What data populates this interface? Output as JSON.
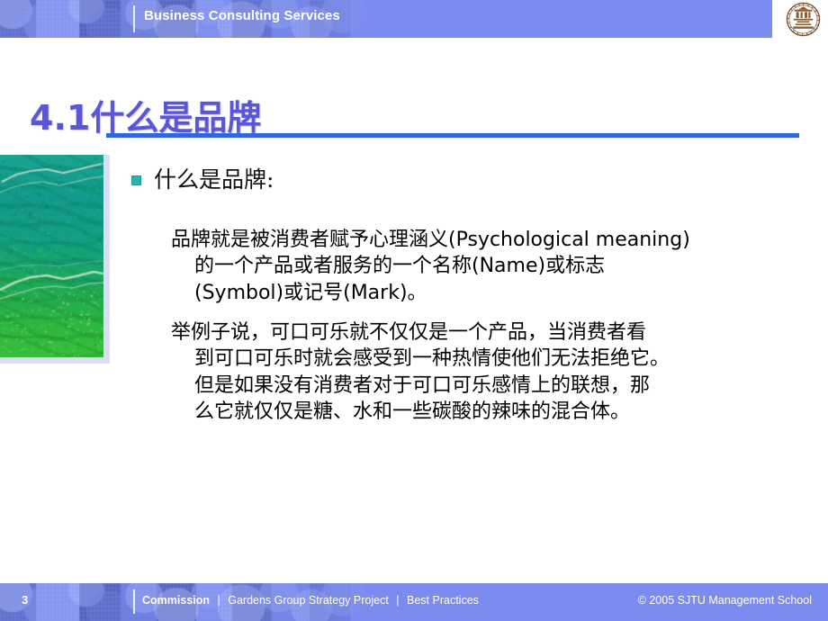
{
  "header": {
    "title": "Business Consulting Services",
    "logo_name": "sjtu-emblem",
    "bg_color": "#7b8bf0"
  },
  "title": {
    "text": "4.1什么是品牌",
    "color": "#5a56d8",
    "rule_color": "#3366dd"
  },
  "photo": {
    "alt": "green mountain landscape photograph",
    "border_color": "#dcdcf6"
  },
  "bullet": {
    "marker_color": "#2ab3b0",
    "text": "什么是品牌:"
  },
  "paragraphs": [
    {
      "id": "para1",
      "lines": [
        "品牌就是被消费者赋予心理涵义(Psychological meaning)",
        "的一个产品或者服务的一个名称(Name)或标志",
        "(Symbol)或记号(Mark)。"
      ]
    },
    {
      "id": "para2",
      "lines": [
        "举例子说，可口可乐就不仅仅是一个产品，当消费者看",
        "到可口可乐时就会感受到一种热情使他们无法拒绝它。",
        "但是如果没有消费者对于可口可乐感情上的联想，那",
        "么它就仅仅是糖、水和一些碳酸的辣味的混合体。"
      ]
    }
  ],
  "footer": {
    "page_number": "3",
    "crumb_1": "Commission",
    "sep_1": "|",
    "crumb_2": "Gardens Group Strategy Project",
    "sep_2": "|",
    "crumb_3": "Best Practices",
    "copyright": "© 2005 SJTU Management School",
    "bg_color": "#7b8bf0"
  }
}
